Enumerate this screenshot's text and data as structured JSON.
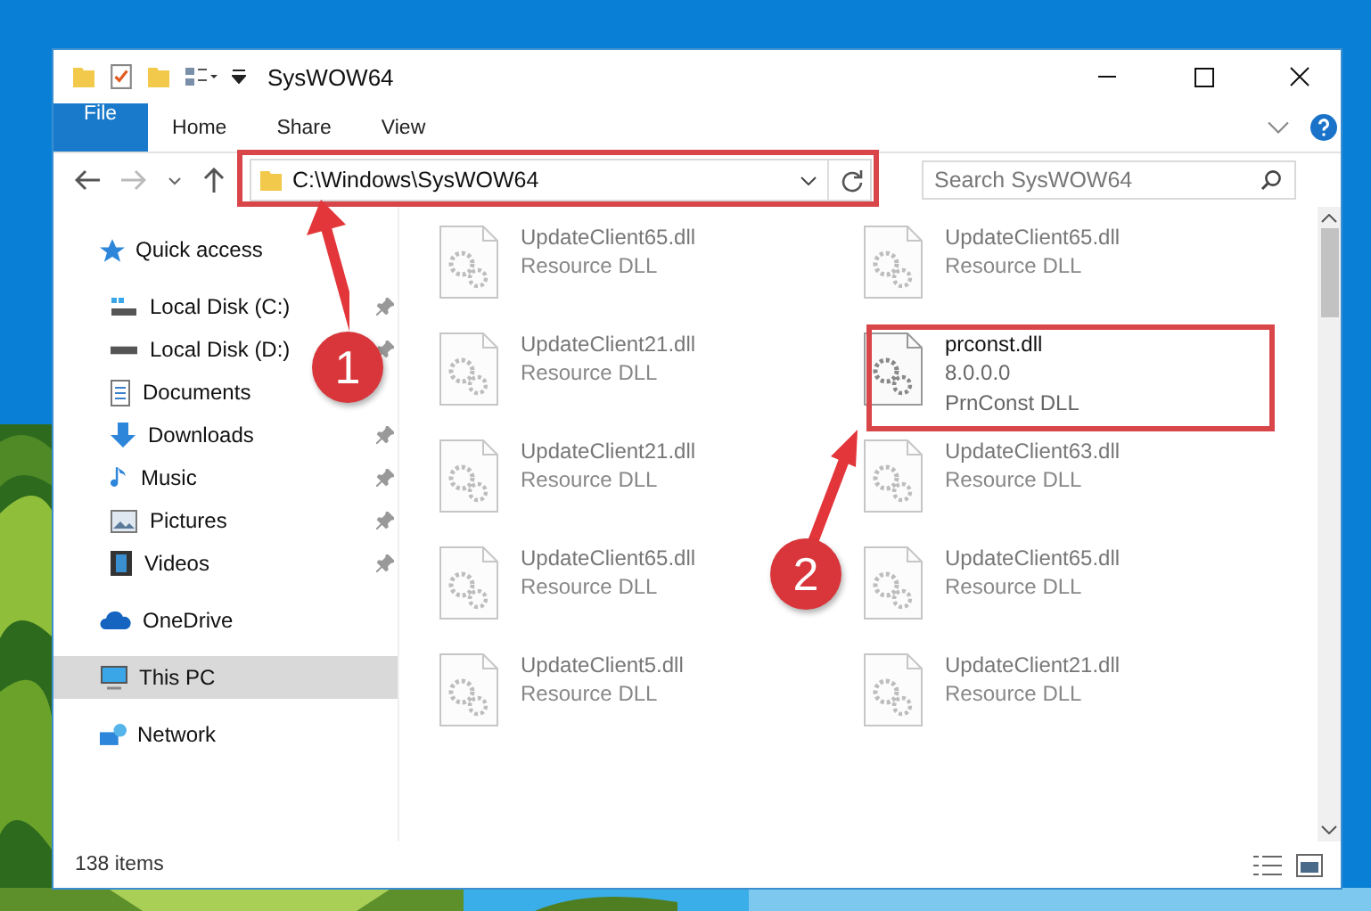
{
  "window": {
    "title": "SysWOW64"
  },
  "tabs": [
    {
      "label": "File",
      "kind": "file"
    },
    {
      "label": "Home",
      "kind": "tab"
    },
    {
      "label": "Share",
      "kind": "tab"
    },
    {
      "label": "View",
      "kind": "tab"
    }
  ],
  "address": {
    "value": "C:\\Windows\\SysWOW64"
  },
  "search": {
    "placeholder": "Search SysWOW64"
  },
  "sidebar": {
    "items": [
      {
        "label": "Quick access",
        "kind": "star",
        "selected": false,
        "children": [
          {
            "label": "Local Disk (C:)",
            "kind": "drive-c",
            "pinned": true,
            "selected": false
          },
          {
            "label": "Local Disk (D:)",
            "kind": "drive",
            "pinned": true,
            "selected": false
          },
          {
            "label": "Documents",
            "kind": "documents",
            "pinned": false,
            "selected": false
          },
          {
            "label": "Downloads",
            "kind": "downloads",
            "pinned": true,
            "selected": false
          },
          {
            "label": "Music",
            "kind": "music",
            "pinned": true,
            "selected": false
          },
          {
            "label": "Pictures",
            "kind": "pictures",
            "pinned": true,
            "selected": false
          },
          {
            "label": "Videos",
            "kind": "videos",
            "pinned": true,
            "selected": false
          }
        ]
      },
      {
        "label": "OneDrive",
        "kind": "cloud",
        "selected": false
      },
      {
        "label": "This PC",
        "kind": "pc",
        "selected": true
      },
      {
        "label": "Network",
        "kind": "network",
        "selected": false
      }
    ]
  },
  "files": [
    {
      "name": "UpdateClient65.dll",
      "details": [
        "Resource DLL"
      ],
      "faded": true
    },
    {
      "name": "UpdateClient65.dll",
      "details": [
        "Resource DLL"
      ],
      "faded": true
    },
    {
      "name": "UpdateClient21.dll",
      "details": [
        "Resource DLL"
      ],
      "faded": true
    },
    {
      "name": "prconst.dll",
      "details": [
        "8.0.0.0",
        "PrnConst DLL"
      ],
      "faded": false
    },
    {
      "name": "UpdateClient21.dll",
      "details": [
        "Resource DLL"
      ],
      "faded": true
    },
    {
      "name": "UpdateClient63.dll",
      "details": [
        "Resource DLL"
      ],
      "faded": true
    },
    {
      "name": "UpdateClient65.dll",
      "details": [
        "Resource DLL"
      ],
      "faded": true
    },
    {
      "name": "UpdateClient65.dll",
      "details": [
        "Resource DLL"
      ],
      "faded": true
    },
    {
      "name": "UpdateClient5.dll",
      "details": [
        "Resource DLL"
      ],
      "faded": true
    },
    {
      "name": "UpdateClient21.dll",
      "details": [
        "Resource DLL"
      ],
      "faded": true
    }
  ],
  "status_bar": {
    "count": "138 items"
  },
  "callouts": [
    {
      "number": "1"
    },
    {
      "number": "2"
    }
  ]
}
